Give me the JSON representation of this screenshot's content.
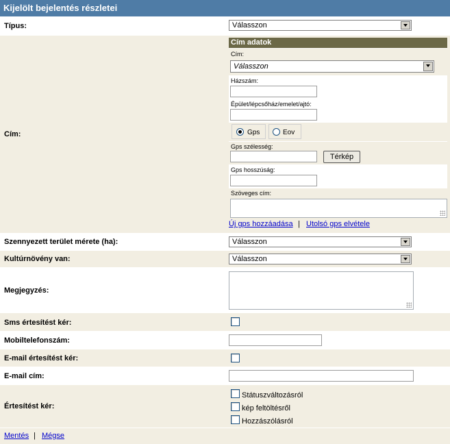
{
  "panel": {
    "title": "Kijelölt bejelentés részletei"
  },
  "tipus": {
    "label": "Típus:",
    "value": "Válasszon"
  },
  "cim": {
    "label": "Cím:",
    "header": "Cím adatok",
    "cim_label": "Cím:",
    "cim_value": "Válasszon",
    "hazszam_label": "Házszám:",
    "epulet_label": "Épület/lépcsőház/emelet/ajtó:",
    "gps_label": "Gps",
    "eov_label": "Eov",
    "gps_szelesseg_label": "Gps szélesség:",
    "terkep_button": "Térkép",
    "gps_hosszusag_label": "Gps hosszúság:",
    "szoveges_label": "Szöveges cím:",
    "uj_gps_link": "Új gps hozzáadása",
    "separator": "|",
    "utolso_gps_link": "Utolsó gps elvétele"
  },
  "terulet": {
    "label": "Szennyezett terület mérete (ha):",
    "value": "Válasszon"
  },
  "kultur": {
    "label": "Kultúrnövény van:",
    "value": "Válasszon"
  },
  "megjegyzes": {
    "label": "Megjegyzés:"
  },
  "sms": {
    "label": "Sms értesítést kér:"
  },
  "mobil": {
    "label": "Mobiltelefonszám:"
  },
  "email_ertesites": {
    "label": "E-mail értesítést kér:"
  },
  "email_cim": {
    "label": "E-mail cím:"
  },
  "ertesites": {
    "label": "Értesítést kér:",
    "options": [
      "Státuszváltozásról",
      "kép feltöltésről",
      "Hozzászólásról"
    ]
  },
  "footer": {
    "save": "Mentés",
    "separator": "|",
    "cancel": "Mégse"
  }
}
